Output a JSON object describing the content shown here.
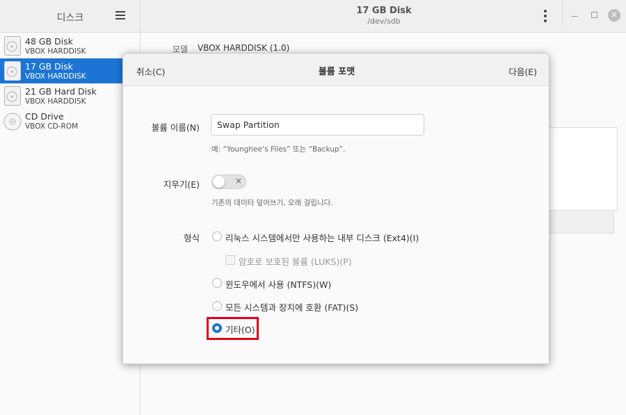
{
  "sidebar": {
    "title": "디스크",
    "disks": [
      {
        "name": "48 GB Disk",
        "sub": "VBOX HARDDISK"
      },
      {
        "name": "17 GB Disk",
        "sub": "VBOX HARDDISK"
      },
      {
        "name": "21 GB Hard Disk",
        "sub": "VBOX HARDDISK"
      },
      {
        "name": "CD Drive",
        "sub": "VBOX CD-ROM"
      }
    ]
  },
  "header": {
    "title": "17 GB Disk",
    "subtitle": "/dev/sdb"
  },
  "main": {
    "model_label": "모델",
    "model_value": "VBOX HARDDISK (1.0)"
  },
  "dialog": {
    "cancel": "취소(C)",
    "title": "볼륨 포맷",
    "next": "다음(E)",
    "name_label": "볼륨 이름(N)",
    "name_value": "Swap Partition",
    "name_hint": "예: “Younghee’s Files” 또는 “Backup”.",
    "erase_label": "지우기(E)",
    "erase_hint": "기존의 데이터 덮어쓰기, 오래 걸립니다.",
    "type_label": "형식",
    "options": [
      "리눅스 시스템에서만 사용하는 내부 디스크 (Ext4)(I)",
      "윈도우에서 사용 (NTFS)(W)",
      "모든 시스템과 장치에 호환 (FAT)(S)",
      "기타(O)"
    ],
    "luks_label": "암호로 보호된 볼륨 (LUKS)(P)",
    "selected_option": "기타(O)"
  },
  "colors": {
    "accent": "#1c75d4",
    "highlight": "#e0001a"
  }
}
